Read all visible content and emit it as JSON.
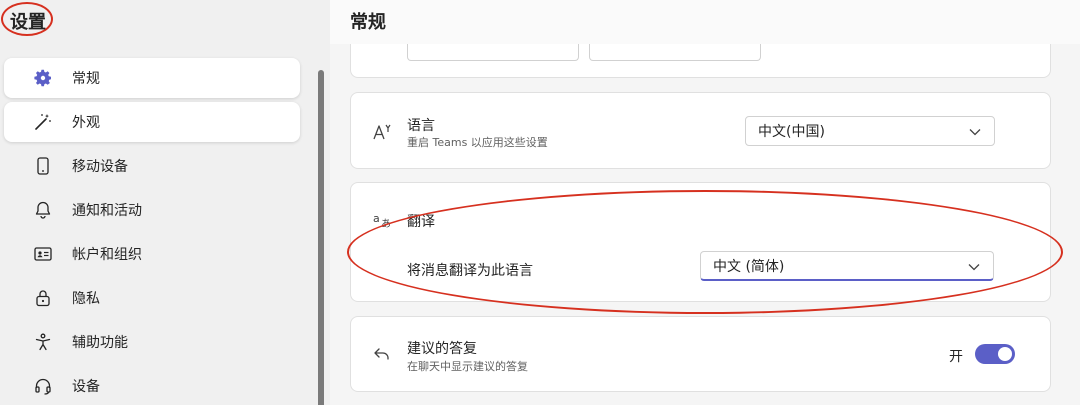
{
  "sidebar": {
    "title": "设置",
    "items": [
      {
        "label": "常规",
        "icon": "gear-icon"
      },
      {
        "label": "外观",
        "icon": "magic-wand-icon"
      },
      {
        "label": "移动设备",
        "icon": "phone-icon"
      },
      {
        "label": "通知和活动",
        "icon": "bell-icon"
      },
      {
        "label": "帐户和组织",
        "icon": "id-card-icon"
      },
      {
        "label": "隐私",
        "icon": "lock-icon"
      },
      {
        "label": "辅助功能",
        "icon": "accessibility-icon"
      },
      {
        "label": "设备",
        "icon": "headset-icon"
      }
    ]
  },
  "main": {
    "title": "常规",
    "language": {
      "title": "语言",
      "subtitle": "重启 Teams 以应用这些设置",
      "value": "中文(中国)",
      "icon": "language-icon"
    },
    "translation": {
      "title": "翻译",
      "label": "将消息翻译为此语言",
      "value": "中文 (简体)",
      "icon": "translate-icon"
    },
    "suggested": {
      "title": "建议的答复",
      "subtitle": "在聊天中显示建议的答复",
      "toggle_label": "开",
      "toggle_on": true,
      "icon": "reply-icon"
    }
  },
  "colors": {
    "accent": "#5b5fc7",
    "annotation": "#d6301f"
  }
}
